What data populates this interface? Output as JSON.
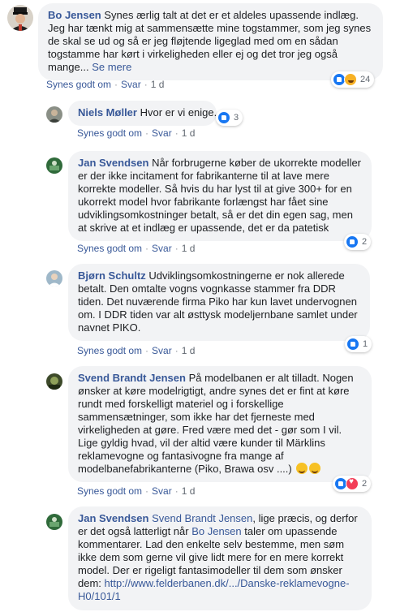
{
  "comments": [
    {
      "author": "Bo Jensen",
      "text": "Synes ærlig talt at det er et aldeles upassende indlæg. Jeg har tænkt mig at sammensætte mine togstammer, som jeg synes de skal se ud og så er jeg fløjtende ligeglad med om en sådan togstamme har kørt i virkeligheden eller ej og det tror jeg også mange...",
      "more": "Se mere",
      "like": "Synes godt om",
      "reply": "Svar",
      "time": "1 d",
      "reaction_count": "24",
      "reactions": [
        "like",
        "haha"
      ]
    },
    {
      "author": "Niels Møller",
      "text": "Hvor er vi enige.",
      "like": "Synes godt om",
      "reply": "Svar",
      "time": "1 d",
      "reaction_count": "3",
      "reactions": [
        "like"
      ]
    },
    {
      "author": "Jan Svendsen",
      "text": "Når forbrugerne køber de ukorrekte modeller er der ikke incitament for fabrikanterne til at lave mere korrekte modeller. Så hvis du har lyst til at give 300+ for en ukorrekt model hvor fabrikante forlængst har fået sine udviklingsomkostninger betalt, så er det din egen sag, men at skrive at et indlæg er upassende, det er da patetisk",
      "like": "Synes godt om",
      "reply": "Svar",
      "time": "1 d",
      "reaction_count": "2",
      "reactions": [
        "like"
      ]
    },
    {
      "author": "Bjørn Schultz",
      "text": "Udviklingsomkostningerne er nok allerede betalt. Den omtalte vogns vognkasse stammer fra DDR tiden. Det nuværende firma Piko har kun lavet undervognen om. I DDR tiden var alt østtysk modeljernbane samlet under navnet PIKO.",
      "like": "Synes godt om",
      "reply": "Svar",
      "time": "1 d",
      "reaction_count": "1",
      "reactions": [
        "like"
      ]
    },
    {
      "author": "Svend Brandt Jensen",
      "text": "På modelbanen er alt tilladt. Nogen ønsker at køre modelrigtigt, andre synes det er fint at køre rundt med forskelligt materiel og i forskellige sammensætninger, som ikke har det fjerneste med virkeligheden at gøre. Fred være med det - gør som I vil. Lige gyldig hvad, vil der altid være kunder til Märklins reklamevogne og fantasivogne fra mange af modelbanefabrikanterne (Piko, Brawa osv ....)",
      "like": "Synes godt om",
      "reply": "Svar",
      "time": "1 d",
      "reaction_count": "2",
      "reactions": [
        "like",
        "love"
      ]
    },
    {
      "author": "Jan Svendsen",
      "mention1": "Svend Brandt Jensen",
      "text_a": ", lige præcis, og derfor er det også latterligt når ",
      "mention2": "Bo Jensen",
      "text_b": " taler om upassende kommentarer. Lad den enkelte selv bestemme, men søm ikke dem som gerne vil give lidt mere for en mere korrekt model. Der er rigeligt fantasimodeller til dem som ønsker dem: ",
      "link": "http://www.felderbanen.dk/.../Danske-reklamevogne-H0/101/1"
    }
  ]
}
